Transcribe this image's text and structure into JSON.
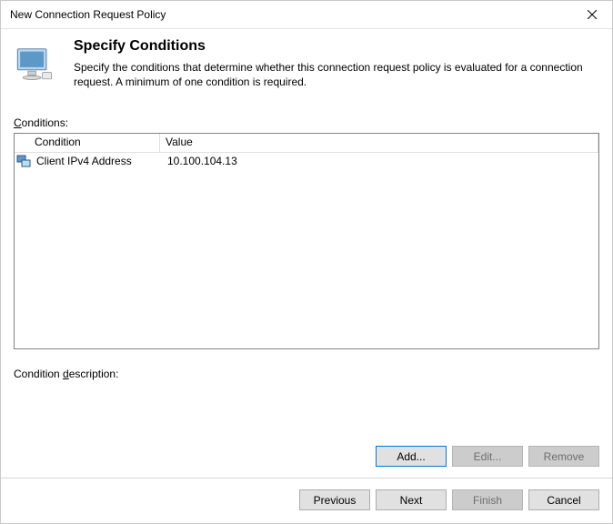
{
  "window": {
    "title": "New Connection Request Policy"
  },
  "header": {
    "heading": "Specify Conditions",
    "subtext": "Specify the conditions that determine whether this connection request policy is evaluated for a connection request. A minimum of one condition is required."
  },
  "labels": {
    "conditions_prefix": "C",
    "conditions_rest": "onditions:",
    "description_prefix": "Condition ",
    "description_u": "d",
    "description_rest": "escription:"
  },
  "table": {
    "columns": {
      "condition": "Condition",
      "value": "Value"
    },
    "rows": [
      {
        "condition": "Client IPv4 Address",
        "value": "10.100.104.13"
      }
    ]
  },
  "buttons": {
    "add": "Add...",
    "edit": "Edit...",
    "remove": "Remove",
    "previous": "Previous",
    "next": "Next",
    "finish": "Finish",
    "cancel": "Cancel"
  }
}
